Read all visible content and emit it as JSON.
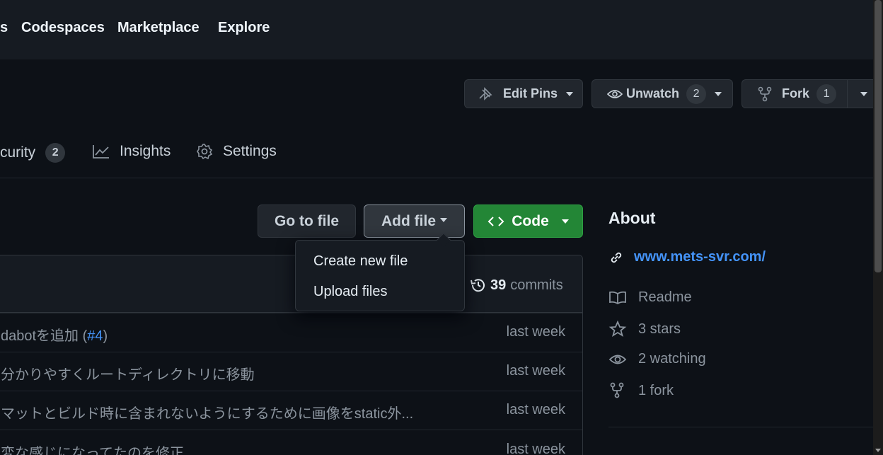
{
  "topnav": {
    "item0": "s",
    "item1": "Codespaces",
    "item2": "Marketplace",
    "item3": "Explore"
  },
  "repo_actions": {
    "edit_pins": "Edit Pins",
    "unwatch": "Unwatch",
    "unwatch_count": "2",
    "fork": "Fork",
    "fork_count": "1"
  },
  "tabs": {
    "security": "curity",
    "security_count": "2",
    "insights": "Insights",
    "settings": "Settings"
  },
  "buttons": {
    "go_to_file": "Go to file",
    "add_file": "Add file",
    "code": "Code"
  },
  "dropdown": {
    "create_new_file": "Create new file",
    "upload_files": "Upload files"
  },
  "commits": {
    "count": "39",
    "label": "commits"
  },
  "files": [
    {
      "msg_before": "dabotを追加 (",
      "link": "#4",
      "msg_after": ")",
      "time": "last week"
    },
    {
      "msg": "分かりやすくルートディレクトリに移動",
      "time": "last week"
    },
    {
      "msg": "マットとビルド時に含まれないようにするために画像をstatic外...",
      "time": "last week"
    },
    {
      "msg": "変な感じになってたのを修正",
      "time": "last week"
    }
  ],
  "about": {
    "title": "About",
    "website": "www.mets-svr.com/",
    "readme": "Readme",
    "stars": "3 stars",
    "watching": "2 watching",
    "forks": "1 fork"
  },
  "colors": {
    "accent_link": "#4493f8",
    "code_button": "#238636",
    "background": "#0d1117"
  }
}
